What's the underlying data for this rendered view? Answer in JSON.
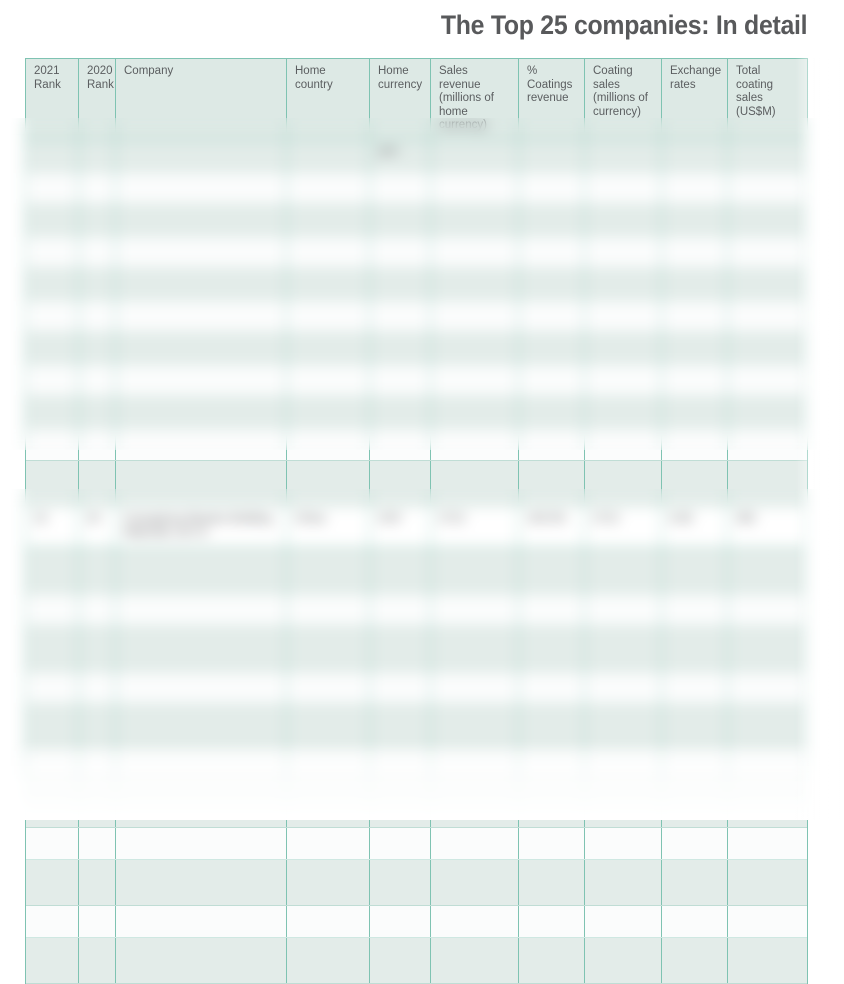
{
  "header": {
    "title": "The Top 25 companies: In detail"
  },
  "table": {
    "columns": [
      "2021 Rank",
      "2020 Rank",
      "Company",
      "Home country",
      "Home currency",
      "Sales revenue (millions of home currency)",
      "% Coatings revenue",
      "Coating sales (millions of currency)",
      "Exchange rates",
      "Total coating sales (US$M)"
    ],
    "columns_display": {
      "rank_2021": "2021\nRank",
      "rank_2020": "2020\nRank",
      "company": "Company",
      "home_country": "Home country",
      "home_currency": "Home\ncurrency",
      "sales_revenue": "Sales revenue\n(millions of\nhome currency)",
      "pct_coatings": "% Coatings\nrevenue",
      "coating_sales": "Coating sales\n(millions of\ncurrency)",
      "exchange_rates": "Exchange\nrates",
      "total_coating_sales": "Total coating\nsales (US$M)"
    },
    "focused_row": {
      "rank_2021": "15",
      "rank_2020": "20",
      "company": "Guangdong Maydos Building Materials Ltd Co",
      "home_country": "China",
      "home_currency": "CNY",
      "sales_revenue": "2713",
      "pct_coatings": "100.0%",
      "coating_sales": "2713",
      "exchange_rates": "6.90",
      "total_coating_sales": "393"
    },
    "obscured_rows_above": [
      {
        "rank_2021": "",
        "rank_2020": "",
        "company": "",
        "home_country": "",
        "home_currency": "JPY",
        "sales_revenue": "",
        "pct_coatings": "",
        "coating_sales": "",
        "exchange_rates": "",
        "total_coating_sales": ""
      },
      {
        "rank_2021": "",
        "rank_2020": "",
        "company": "",
        "home_country": "",
        "home_currency": "",
        "sales_revenue": "",
        "pct_coatings": "",
        "coating_sales": "",
        "exchange_rates": "",
        "total_coating_sales": ""
      },
      {
        "rank_2021": "",
        "rank_2020": "",
        "company": "",
        "home_country": "",
        "home_currency": "",
        "sales_revenue": "",
        "pct_coatings": "",
        "coating_sales": "",
        "exchange_rates": "",
        "total_coating_sales": ""
      },
      {
        "rank_2021": "",
        "rank_2020": "",
        "company": "",
        "home_country": "",
        "home_currency": "",
        "sales_revenue": "",
        "pct_coatings": "",
        "coating_sales": "",
        "exchange_rates": "",
        "total_coating_sales": ""
      },
      {
        "rank_2021": "",
        "rank_2020": "",
        "company": "",
        "home_country": "",
        "home_currency": "",
        "sales_revenue": "",
        "pct_coatings": "",
        "coating_sales": "",
        "exchange_rates": "",
        "total_coating_sales": ""
      },
      {
        "rank_2021": "",
        "rank_2020": "",
        "company": "",
        "home_country": "",
        "home_currency": "",
        "sales_revenue": "",
        "pct_coatings": "",
        "coating_sales": "",
        "exchange_rates": "",
        "total_coating_sales": ""
      },
      {
        "rank_2021": "",
        "rank_2020": "",
        "company": "",
        "home_country": "",
        "home_currency": "",
        "sales_revenue": "",
        "pct_coatings": "",
        "coating_sales": "",
        "exchange_rates": "",
        "total_coating_sales": ""
      },
      {
        "rank_2021": "",
        "rank_2020": "",
        "company": "",
        "home_country": "",
        "home_currency": "",
        "sales_revenue": "",
        "pct_coatings": "",
        "coating_sales": "",
        "exchange_rates": "",
        "total_coating_sales": ""
      },
      {
        "rank_2021": "",
        "rank_2020": "",
        "company": "",
        "home_country": "",
        "home_currency": "",
        "sales_revenue": "",
        "pct_coatings": "",
        "coating_sales": "",
        "exchange_rates": "",
        "total_coating_sales": ""
      },
      {
        "rank_2021": "",
        "rank_2020": "",
        "company": "",
        "home_country": "",
        "home_currency": "",
        "sales_revenue": "",
        "pct_coatings": "",
        "coating_sales": "",
        "exchange_rates": "",
        "total_coating_sales": ""
      },
      {
        "rank_2021": "",
        "rank_2020": "",
        "company": "",
        "home_country": "",
        "home_currency": "",
        "sales_revenue": "",
        "pct_coatings": "",
        "coating_sales": "",
        "exchange_rates": "",
        "total_coating_sales": ""
      }
    ],
    "obscured_rows_below": [
      {
        "rank_2021": "",
        "rank_2020": "",
        "company": "",
        "home_country": "",
        "home_currency": "",
        "sales_revenue": "",
        "pct_coatings": "",
        "coating_sales": "",
        "exchange_rates": "",
        "total_coating_sales": ""
      },
      {
        "rank_2021": "",
        "rank_2020": "",
        "company": "",
        "home_country": "",
        "home_currency": "",
        "sales_revenue": "",
        "pct_coatings": "",
        "coating_sales": "",
        "exchange_rates": "",
        "total_coating_sales": ""
      },
      {
        "rank_2021": "",
        "rank_2020": "",
        "company": "",
        "home_country": "",
        "home_currency": "",
        "sales_revenue": "",
        "pct_coatings": "",
        "coating_sales": "",
        "exchange_rates": "",
        "total_coating_sales": ""
      },
      {
        "rank_2021": "",
        "rank_2020": "",
        "company": "",
        "home_country": "",
        "home_currency": "",
        "sales_revenue": "",
        "pct_coatings": "",
        "coating_sales": "",
        "exchange_rates": "",
        "total_coating_sales": ""
      },
      {
        "rank_2021": "",
        "rank_2020": "",
        "company": "",
        "home_country": "",
        "home_currency": "",
        "sales_revenue": "",
        "pct_coatings": "",
        "coating_sales": "",
        "exchange_rates": "",
        "total_coating_sales": ""
      },
      {
        "rank_2021": "",
        "rank_2020": "",
        "company": "",
        "home_country": "",
        "home_currency": "",
        "sales_revenue": "",
        "pct_coatings": "",
        "coating_sales": "",
        "exchange_rates": "",
        "total_coating_sales": ""
      },
      {
        "rank_2021": "",
        "rank_2020": "",
        "company": "",
        "home_country": "",
        "home_currency": "",
        "sales_revenue": "",
        "pct_coatings": "",
        "coating_sales": "",
        "exchange_rates": "",
        "total_coating_sales": ""
      },
      {
        "rank_2021": "",
        "rank_2020": "",
        "company": "",
        "home_country": "",
        "home_currency": "",
        "sales_revenue": "",
        "pct_coatings": "",
        "coating_sales": "",
        "exchange_rates": "",
        "total_coating_sales": ""
      },
      {
        "rank_2021": "",
        "rank_2020": "",
        "company": "",
        "home_country": "",
        "home_currency": "",
        "sales_revenue": "",
        "pct_coatings": "",
        "coating_sales": "",
        "exchange_rates": "",
        "total_coating_sales": ""
      },
      {
        "rank_2021": "",
        "rank_2020": "",
        "company": "",
        "home_country": "",
        "home_currency": "",
        "sales_revenue": "",
        "pct_coatings": "",
        "coating_sales": "",
        "exchange_rates": "",
        "total_coating_sales": ""
      },
      {
        "rank_2021": "",
        "rank_2020": "",
        "company": "",
        "home_country": "",
        "home_currency": "",
        "sales_revenue": "",
        "pct_coatings": "",
        "coating_sales": "",
        "exchange_rates": "",
        "total_coating_sales": ""
      }
    ]
  },
  "colors": {
    "accent_teal": "#2f9a83",
    "border_teal": "#7fc3b2",
    "header_bg": "#dde9e5",
    "row_alt_bg": "#e3ece9",
    "row_bg": "#fbfcfc",
    "title_gray": "#58595b",
    "body_text": "#5b5e60"
  }
}
